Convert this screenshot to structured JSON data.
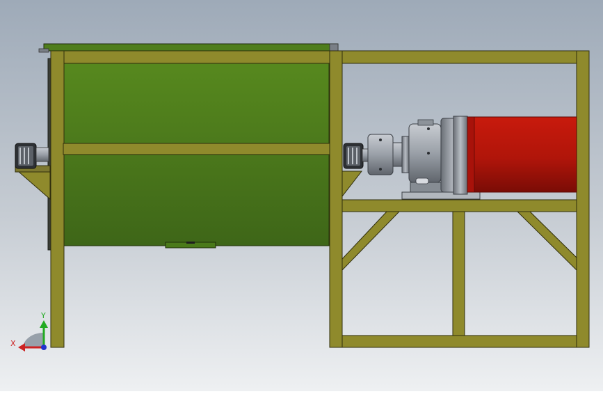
{
  "viewport": {
    "background_top": "#9eaab8",
    "background_mid": "#c6ccd3",
    "background_bottom": "#eef0f2"
  },
  "colors": {
    "frame_fill": "#8f8a2c",
    "frame_stroke": "#2f2d0c",
    "hopper_light": "#57891e",
    "hopper_dark": "#3e6618",
    "motor_red": "#c81a0c",
    "motor_red_dark": "#7a0c06",
    "gearbox_gray": "#9aa0a8",
    "gearbox_dark": "#4c5158",
    "bearing_dark": "#2a2d31"
  },
  "triad": {
    "x_label": "X",
    "y_label": "Y",
    "x_color": "#cc2222",
    "y_color": "#22aa22",
    "z_color": "#2233cc"
  }
}
